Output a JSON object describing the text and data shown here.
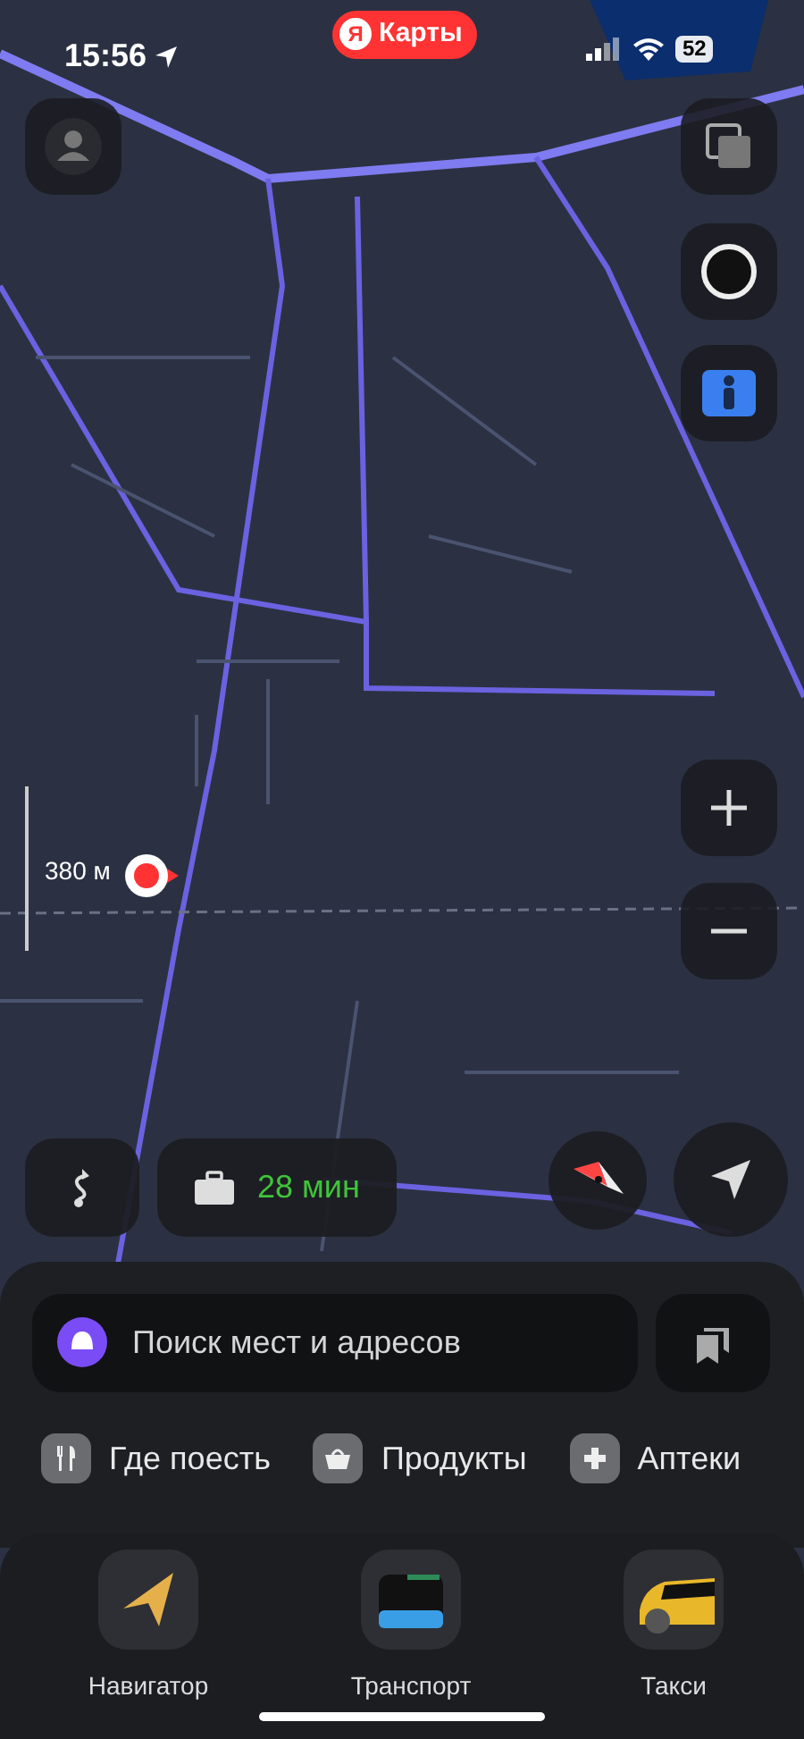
{
  "status_bar": {
    "time": "15:56",
    "battery": "52"
  },
  "app_badge": {
    "logo": "Я",
    "label": "Карты"
  },
  "map": {
    "kind": "picture",
    "scale": "380 м"
  },
  "commute": {
    "eta": "28 мин"
  },
  "search": {
    "placeholder": "Поиск мест и адресов"
  },
  "categories": [
    {
      "label": "Где поесть",
      "kind": "food"
    },
    {
      "label": "Продукты",
      "kind": "groceries"
    },
    {
      "label": "Аптеки",
      "kind": "pharmacy"
    }
  ],
  "apps": [
    {
      "label": "Навигатор",
      "kind": "navigator"
    },
    {
      "label": "Транспорт",
      "kind": "transport"
    },
    {
      "label": "Такси",
      "kind": "taxi"
    }
  ]
}
